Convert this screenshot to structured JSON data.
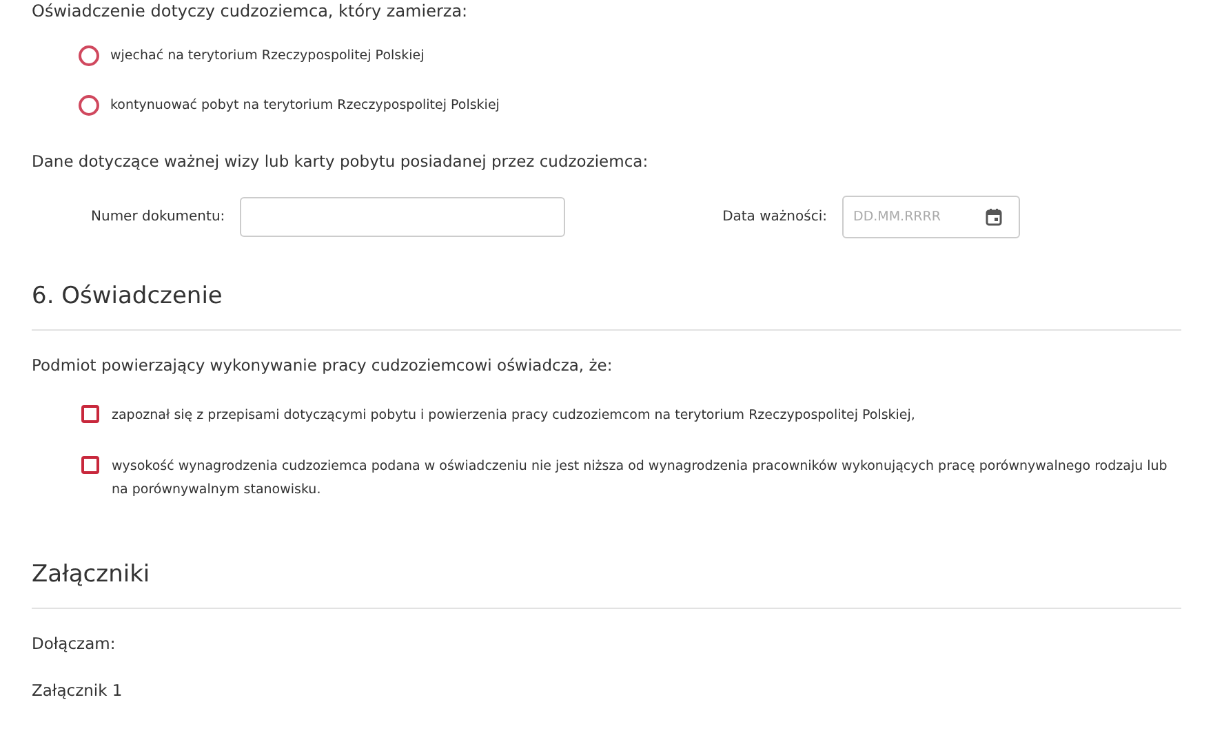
{
  "intro": "Oświadczenie dotyczy cudzoziemca, który zamierza:",
  "purpose_options": [
    {
      "label": "wjechać na terytorium Rzeczypospolitej Polskiej",
      "selected": false
    },
    {
      "label": "kontynuować pobyt na terytorium Rzeczypospolitej Polskiej",
      "selected": false
    }
  ],
  "visa_section": {
    "label": "Dane dotyczące ważnej wizy lub karty pobytu posiadanej przez cudzoziemca:",
    "document_number": {
      "label": "Numer dokumentu:"
    },
    "expiry_date": {
      "label": "Data ważności:",
      "placeholder": "DD.MM.RRRR"
    }
  },
  "declaration": {
    "title": "6. Oświadczenie",
    "intro": "Podmiot powierzający wykonywanie pracy cudzoziemcowi oświadcza, że:",
    "items": [
      {
        "label": "zapoznał się z przepisami dotyczącymi pobytu i powierzenia pracy cudzoziemcom na terytorium Rzeczypospolitej Polskiej,",
        "checked": false
      },
      {
        "label": "wysokość wynagrodzenia cudzoziemca podana w oświadczeniu nie jest niższa od wynagrodzenia pracowników wykonujących pracę porównywalnego rodzaju lub na porównywalnym stanowisku.",
        "checked": false
      }
    ]
  },
  "attachments": {
    "title": "Załączniki",
    "label": "Dołączam:",
    "items": [
      "Załącznik 1"
    ]
  }
}
